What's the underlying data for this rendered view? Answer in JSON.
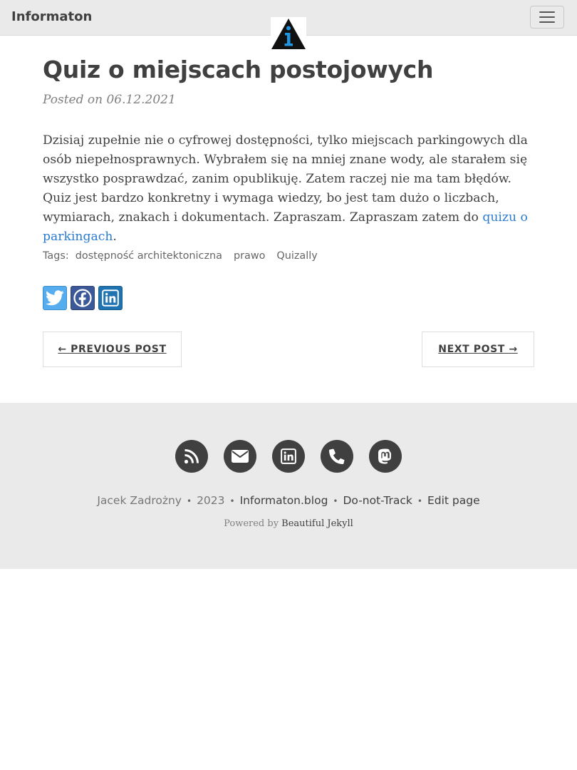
{
  "navbar": {
    "brand": "Informaton",
    "menu_icon": "hamburger-menu-icon",
    "logo_icon": "info-triangle-logo",
    "logo_letter": "i"
  },
  "post": {
    "title": "Quiz o miejscach postojowych",
    "posted_on": "Posted on 06.12.2021",
    "body_text": "Dzisiaj zupełnie nie o cyfrowej dostępności, tylko miejscach parkingowych dla osób niepełnosprawnych. Wybrałem się na mniej znane wody, ale starałem się wszystko posprawdzać, zanim opublikuję. Zatem raczej nie ma tam błędów. Quiz jest bardzo konkretny i wymaga wiedzy, bo jest tam dużo o liczbach, wymiarach, znakach i dokumentach. Zapraszam. Zapraszam zatem do ",
    "link_text": "quizu o parkingach",
    "body_end": ".",
    "tags_label": "Tags:",
    "tags": [
      "dostępność architektoniczna",
      "prawo",
      "Quizally"
    ]
  },
  "share": [
    {
      "icon": "twitter-icon"
    },
    {
      "icon": "facebook-icon"
    },
    {
      "icon": "linkedin-icon"
    }
  ],
  "pager": {
    "prev": "← PREVIOUS POST",
    "next": "NEXT POST →"
  },
  "footer": {
    "social_icons": [
      "rss-icon",
      "envelope-icon",
      "linkedin-icon",
      "phone-icon",
      "mastodon-icon"
    ],
    "author": "Jacek Zadrożny",
    "year": "2023",
    "blog_link": "Informaton.blog",
    "dnt_link": "Do-not-Track",
    "edit_link": "Edit page",
    "separator": "•",
    "powered_by": "Powered by ",
    "theme_link": "Beautiful Jekyll"
  },
  "colors": {
    "navbar_bg": "#eaeaea",
    "link": "#2b7bd0",
    "text": "#404040",
    "twitter": "#55acee",
    "facebook": "#3b5998",
    "linkedin": "#1f73b0"
  }
}
